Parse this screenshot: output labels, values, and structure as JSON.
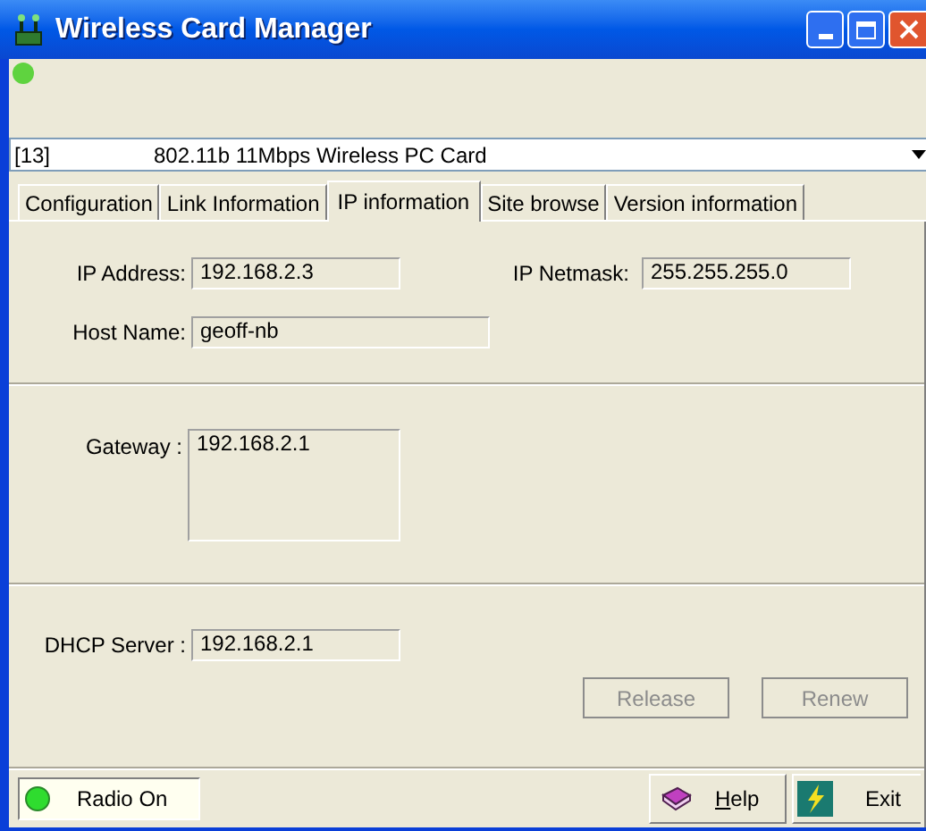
{
  "window": {
    "title": "Wireless Card Manager"
  },
  "device_select": {
    "value_index": "[13]",
    "value_name": "802.11b 11Mbps Wireless PC Card"
  },
  "tabs": [
    {
      "label": "Configuration",
      "selected": false
    },
    {
      "label": "Link Information",
      "selected": false
    },
    {
      "label": "IP information",
      "selected": true
    },
    {
      "label": "Site browse",
      "selected": false
    },
    {
      "label": "Version information",
      "selected": false
    }
  ],
  "ip_address": {
    "label": "IP Address:",
    "value": "192.168.2.3"
  },
  "ip_netmask": {
    "label": "IP Netmask:",
    "value": "255.255.255.0"
  },
  "host_name": {
    "label": "Host Name:",
    "value": "geoff-nb"
  },
  "gateway": {
    "label": "Gateway :",
    "value": "192.168.2.1"
  },
  "dhcp_server": {
    "label": "DHCP Server :",
    "value": "192.168.2.1"
  },
  "buttons": [
    {
      "label": "Release",
      "disabled": true
    },
    {
      "label": "Renew",
      "disabled": true
    }
  ],
  "status_bar": {
    "radio": {
      "label": "Radio On",
      "on": true
    },
    "help": "Help",
    "exit": "Exit"
  }
}
